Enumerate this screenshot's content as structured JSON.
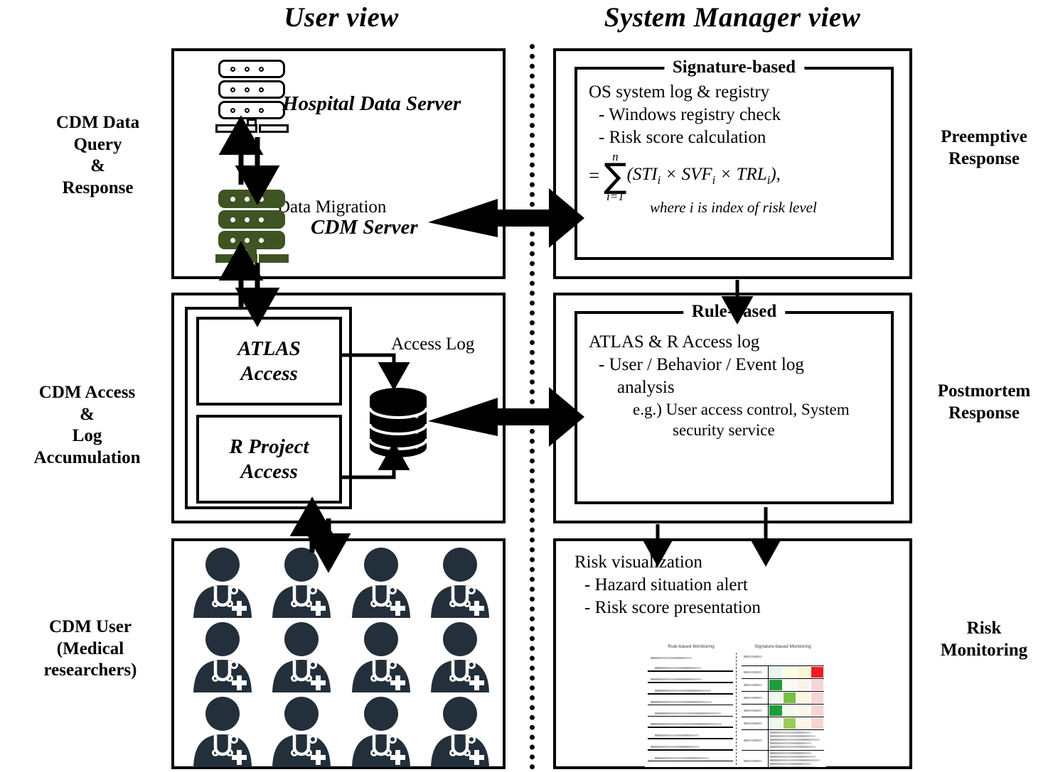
{
  "titles": {
    "left": "User view",
    "right": "System Manager view"
  },
  "left_labels": [
    {
      "id": "cdm-data-query-response",
      "lines": [
        "CDM Data",
        "Query",
        "&",
        "Response"
      ]
    },
    {
      "id": "cdm-access-log-accumulation",
      "lines": [
        "CDM Access",
        "&",
        "Log",
        "Accumulation"
      ]
    },
    {
      "id": "cdm-user",
      "lines": [
        "CDM User",
        "(Medical",
        "researchers)"
      ]
    }
  ],
  "right_labels": [
    {
      "id": "preemptive-response",
      "lines": [
        "Preemptive",
        "Response"
      ]
    },
    {
      "id": "postmortem-response",
      "lines": [
        "Postmortem",
        "Response"
      ]
    },
    {
      "id": "risk-monitoring",
      "lines": [
        "Risk",
        "Monitoring"
      ]
    }
  ],
  "user_view": {
    "panel1": {
      "hospital_server_label": "Hospital Data Server",
      "cdm_server_label": "CDM Server",
      "migration_label": "Data Migration"
    },
    "panel2": {
      "atlas_box": "ATLAS\nAccess",
      "atlas_box_line1": "ATLAS",
      "atlas_box_line2": "Access",
      "r_box_line1": "R Project",
      "r_box_line2": "Access",
      "access_log_label": "Access  Log"
    },
    "panel3": {
      "doctor_count": 12
    }
  },
  "manager_view": {
    "signature_based": {
      "legend": "Signature-based",
      "lines": [
        {
          "text": "OS system log & registry",
          "indent": 0
        },
        {
          "text": "- Windows registry check",
          "indent": 1
        },
        {
          "text": "- Risk score calculation",
          "indent": 1
        }
      ],
      "formula": {
        "equals": "=",
        "sigma_top": "n",
        "sigma_glyph": "∑",
        "sigma_bottom": "i=1",
        "body_open": "(",
        "terms": [
          "STI",
          "SVF",
          "TRL"
        ],
        "term_sub": "i",
        "operator": "×",
        "body_close": "),",
        "note": "where i is index of risk level"
      }
    },
    "rule_based": {
      "legend": "Rule-based",
      "lines": [
        {
          "text": "ATLAS & R Access log",
          "indent": 0
        },
        {
          "text": "- User / Behavior / Event log",
          "indent": 1
        },
        {
          "text": "analysis",
          "indent": 2
        },
        {
          "text": "e.g.) User access control, System",
          "indent": 3
        },
        {
          "text": "security service",
          "indent": 3
        }
      ]
    },
    "risk_panel": {
      "lines": [
        {
          "text": "Risk visualization",
          "indent": 0
        },
        {
          "text": "- Hazard situation alert",
          "indent": 1
        },
        {
          "text": "- Risk score presentation",
          "indent": 1
        }
      ],
      "thumbnail": {
        "left_title": "Rule-based Monitoring",
        "right_title": "Signature-based Monitoring",
        "left_rows": [
          "ACCESS Project",
          "Rule 1: 553,049",
          "+ Rule   556",
          "Rule 4: 62,168,788",
          "+ Rule 4: 406,865,112",
          "R Study (SMID)",
          "+ Rule 5",
          "Rule 6: 72",
          "+ Rule 7: 48,70",
          "Rule 8"
        ],
        "right_header": "Category",
        "right_rows": [
          "Structural",
          "regulatory",
          "Process-based",
          "Sensor-based",
          "Measurement",
          "grid-alerts",
          "risk-detail"
        ]
      }
    }
  },
  "colors": {
    "server_green": "#3e5423",
    "doctor_navy": "#232f3a",
    "line_black": "#000000",
    "heat_red": "#ee1c25",
    "heat_green": "#1e9d3d"
  }
}
